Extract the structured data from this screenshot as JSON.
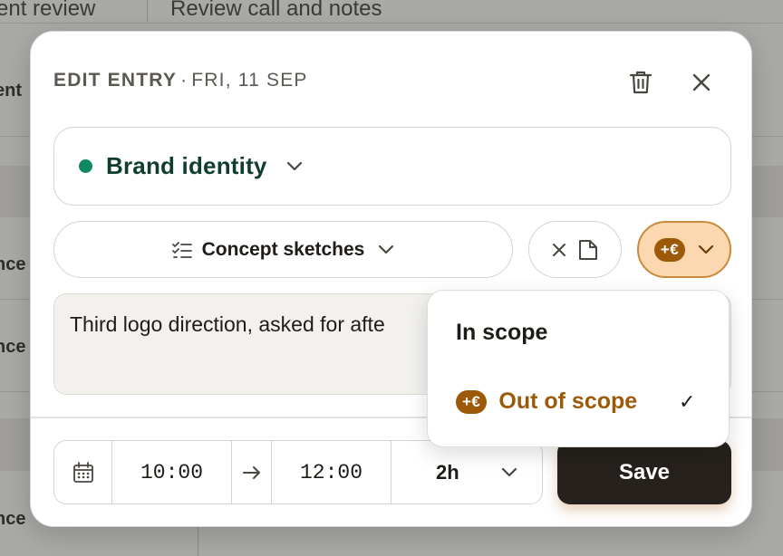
{
  "background": {
    "header_left": "ent review",
    "header_right": "Review call and notes",
    "row_labels": [
      "ent",
      "nce",
      "nce",
      "nce"
    ]
  },
  "modal": {
    "title": "EDIT ENTRY",
    "title_separator": "·",
    "date": "FRI, 11 SEP",
    "delete_icon": "trash-icon",
    "close_icon": "close-icon"
  },
  "project": {
    "label": "Brand identity",
    "dot_color": "#0f8a5f"
  },
  "task": {
    "label": "Concept sketches",
    "icon": "checklist-icon"
  },
  "attachment_button": {
    "icons": [
      "close-icon",
      "document-icon"
    ]
  },
  "scope_button": {
    "badge": "+€",
    "accent": "#9c5a09",
    "background": "#fbd8b0"
  },
  "notes": {
    "value": "Third logo direction, asked for afte"
  },
  "time": {
    "start": "10:00",
    "end": "12:00",
    "duration": "2h"
  },
  "save_label": "Save",
  "scope_menu": {
    "in_scope_label": "In scope",
    "out_of_scope_badge": "+€",
    "out_of_scope_label": "Out of scope",
    "selected_mark": "✓"
  }
}
